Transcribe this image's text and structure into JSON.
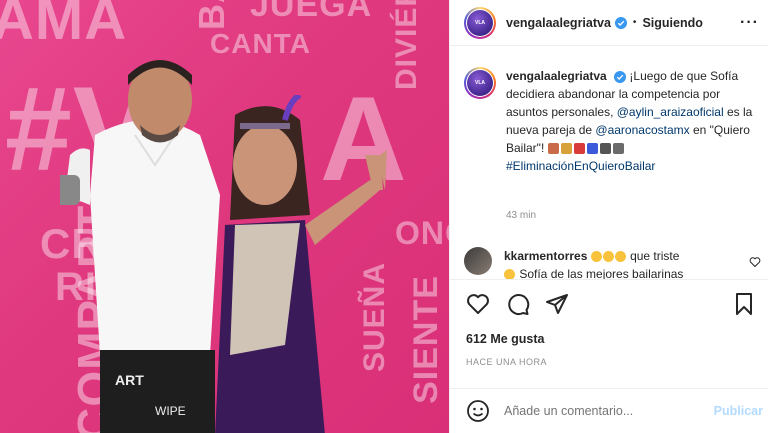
{
  "photo": {
    "bg_words": [
      "AMA",
      "BA",
      "JUEGA",
      "CANTA",
      "#V",
      "A",
      "CR",
      "COMPARTE",
      "RI",
      "SUEÑA",
      "SIENTE",
      "DIVIÉRTE",
      "ONO"
    ]
  },
  "post": {
    "username": "vengalaalegriatva",
    "follow_label": "Siguiendo",
    "caption_prefix": "¡Luego de que Sofía decidiera abandonar la competencia por asuntos personales, ",
    "mention_1": "@aylin_araizaoficial",
    "caption_mid": " es la nueva pareja de ",
    "mention_2": "@aaronacostamx",
    "caption_suffix": " en \"Quiero Bailar\"! ",
    "hashtag": "#EliminaciónEnQuieroBailar",
    "time": "43 min",
    "likes": "612 Me gusta",
    "posted_ago": "HACE UNA HORA"
  },
  "comment": {
    "username": "kkarmentorres",
    "text": "que triste",
    "second_line": " Sofía de las mejores bailarinas"
  },
  "composer": {
    "placeholder": "Añade un comentario...",
    "publish_label": "Publicar"
  },
  "colors": {
    "link": "#00376b",
    "verified": "#3897f0",
    "publish_disabled": "#b3dbff",
    "photo_bg": "#e0397f"
  },
  "icons": [
    "verified-badge-icon",
    "more-options-icon",
    "heart-icon",
    "comment-icon",
    "share-icon",
    "bookmark-icon",
    "emoji-icon"
  ]
}
